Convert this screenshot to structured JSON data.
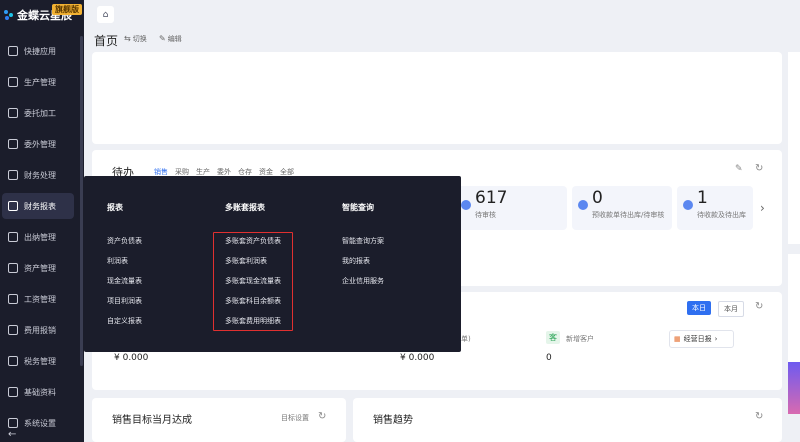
{
  "brand": {
    "logo_text": "金蝶云星辰",
    "edition_badge": "旗舰版"
  },
  "sidebar": {
    "items": [
      {
        "label": "快捷应用",
        "icon": "apps-icon"
      },
      {
        "label": "生产管理",
        "icon": "factory-icon"
      },
      {
        "label": "委托加工",
        "icon": "tools-icon"
      },
      {
        "label": "委外管理",
        "icon": "outsource-icon"
      },
      {
        "label": "财务处理",
        "icon": "finance-icon"
      },
      {
        "label": "财务报表",
        "icon": "report-icon"
      },
      {
        "label": "出纳管理",
        "icon": "cashier-icon"
      },
      {
        "label": "资产管理",
        "icon": "asset-icon"
      },
      {
        "label": "工资管理",
        "icon": "salary-icon"
      },
      {
        "label": "费用报销",
        "icon": "expense-icon"
      },
      {
        "label": "税务管理",
        "icon": "tax-icon"
      },
      {
        "label": "基础资料",
        "icon": "database-icon"
      },
      {
        "label": "系统设置",
        "icon": "settings-icon"
      }
    ],
    "active_index": 5,
    "collapse_glyph": "←"
  },
  "header": {
    "home_glyph": "⌂",
    "page_title": "首页",
    "switch_label": "切换",
    "edit_label": "编辑"
  },
  "todo": {
    "title": "待办",
    "tabs": [
      "销售",
      "采购",
      "生产",
      "委外",
      "仓存",
      "资金",
      "全部"
    ],
    "active_tab": 0,
    "stats": [
      {
        "value": "617",
        "label": "待审核"
      },
      {
        "value": "0",
        "label": "预收款单待出库/待审核"
      },
      {
        "value": "1",
        "label": "待收款及待出库"
      }
    ],
    "next_glyph": "›"
  },
  "report_panel": {
    "day_label": "本日",
    "month_label": "本月",
    "business_daily_label": "经营日报",
    "amount_1": "¥ 0.000",
    "amount_2": "¥ 0.000",
    "count_label": "0",
    "new_customer_label": "新增客户",
    "new_customer_glyph": "客",
    "partial_text": "单)"
  },
  "sales_target": {
    "title": "销售目标当月达成",
    "setting_label": "目标设置"
  },
  "sales_trend": {
    "title": "销售趋势"
  },
  "dropdown": {
    "columns": [
      {
        "title": "报表",
        "items": [
          "资产负债表",
          "利润表",
          "现金流量表",
          "项目利润表",
          "自定义报表"
        ]
      },
      {
        "title": "多账套报表",
        "items": [
          "多账套资产负债表",
          "多账套利润表",
          "多账套现金流量表",
          "多账套科目余额表",
          "多账套费用明细表"
        ]
      },
      {
        "title": "智能查询",
        "items": [
          "智能查询方案",
          "我的报表",
          "企业信用服务"
        ]
      }
    ]
  }
}
